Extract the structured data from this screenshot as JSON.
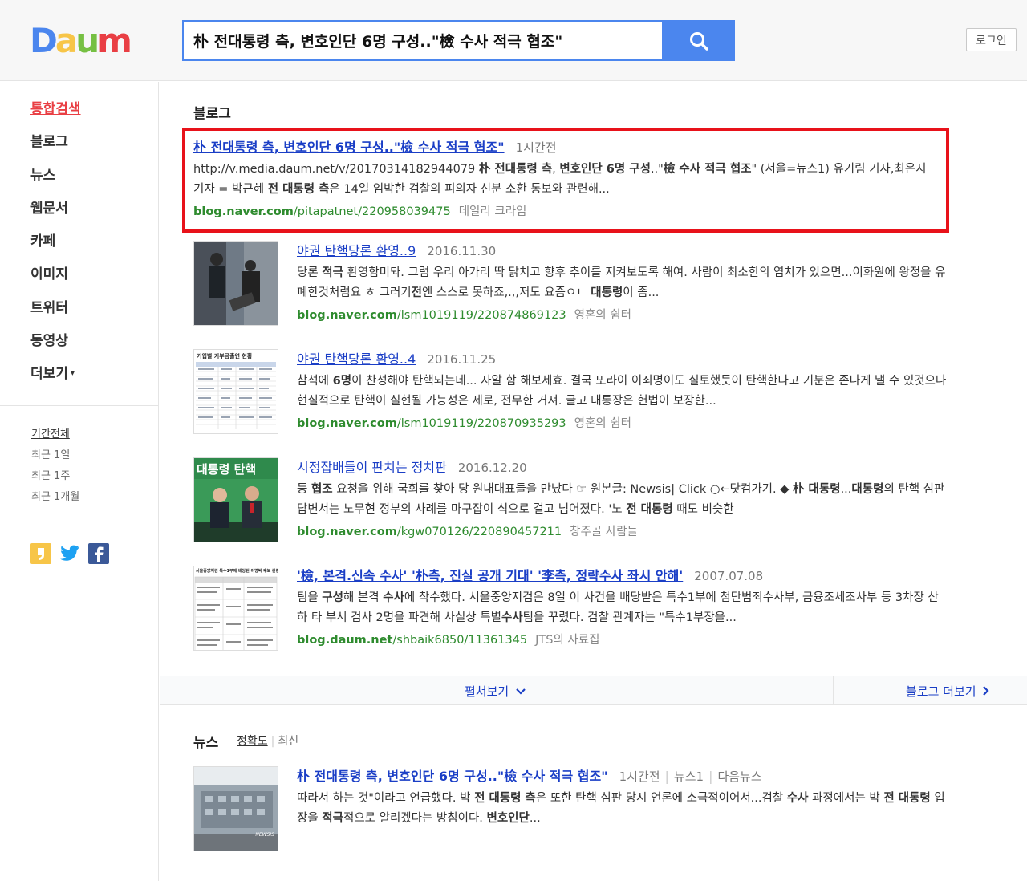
{
  "header": {
    "logo_letters": [
      "D",
      "a",
      "u",
      "m"
    ],
    "logo_colors": [
      "#4b86ee",
      "#f7c548",
      "#76c043",
      "#e93f44"
    ],
    "search_query": "朴 전대통령 측, 변호인단 6명 구성..\"檢 수사 적극 협조\"",
    "search_icon": "search-icon",
    "login_label": "로그인"
  },
  "sidebar": {
    "nav": [
      {
        "label": "통합검색",
        "active": true
      },
      {
        "label": "블로그"
      },
      {
        "label": "뉴스"
      },
      {
        "label": "웹문서"
      },
      {
        "label": "카페"
      },
      {
        "label": "이미지"
      },
      {
        "label": "트위터"
      },
      {
        "label": "동영상"
      },
      {
        "label": "더보기"
      }
    ],
    "more_caret": "▾",
    "period": [
      {
        "label": "기간전체",
        "active": true
      },
      {
        "label": "최근 1일"
      },
      {
        "label": "최근 1주"
      },
      {
        "label": "최근 1개월"
      }
    ],
    "share_icons": [
      "daum-story-icon",
      "twitter-icon",
      "facebook-icon"
    ],
    "colors": {
      "story": "#f7c548",
      "twitter": "#1da1f2",
      "facebook": "#3b5998"
    }
  },
  "blog": {
    "section_title": "블로그",
    "results": [
      {
        "title": "朴 전대통령 측, 변호인단 6명 구성..\"檢 수사 적극 협조\"",
        "date": "1시간전",
        "desc_parts": [
          {
            "t": "http://v.media.daum.net/v/20170314182944079 "
          },
          {
            "t": "朴 전대통령 측",
            "b": true
          },
          {
            "t": ", "
          },
          {
            "t": "변호인단 6명 구성",
            "b": true
          },
          {
            "t": "..\""
          },
          {
            "t": "檢 수사 적극 협조",
            "b": true
          },
          {
            "t": "\" (서울=뉴스1) 유기림 기자,최은지 기자 = 박근혜 "
          },
          {
            "t": "전 대통령 측",
            "b": true
          },
          {
            "t": "은 14일 임박한 검찰의 피의자 신분 소환 통보와 관련해..."
          }
        ],
        "url_domain": "blog.naver.com",
        "url_path": "/pitapatnet/220958039475",
        "source": "데일리 크라임"
      },
      {
        "title": "야권 탄핵당론 환영..9",
        "date": "2016.11.30",
        "desc_parts": [
          {
            "t": "당론 "
          },
          {
            "t": "적극",
            "b": true
          },
          {
            "t": " 환영함미돠. 그럼 우리 아가리 딱 닭치고 향후 추이를 지켜보도록 해여. 사람이 최소한의 염치가 있으면...이화원에 왕정을 유폐한것처럼요 ㅎ 그러기"
          },
          {
            "t": "전",
            "b": true
          },
          {
            "t": "엔 스스로 못하죠,.,,저도 요즘ㅇㄴ "
          },
          {
            "t": "대통령",
            "b": true
          },
          {
            "t": "이 좀..."
          }
        ],
        "url_domain": "blog.naver.com",
        "url_path": "/lsm1019119/220874869123",
        "source": "영혼의 쉼터"
      },
      {
        "title": "야권 탄핵당론 환영..4",
        "date": "2016.11.25",
        "thumb_label": "기업별 기부금출연 현황",
        "desc_parts": [
          {
            "t": "참석에 "
          },
          {
            "t": "6명",
            "b": true
          },
          {
            "t": "이 찬성해야 탄핵되는데... 자알 함 해보세효. 결국 또라이 이죄명이도 실토했듯이 탄핵한다고 기분은 존나게 낼 수 있것으나 현실적으로 탄핵이 실현될 가능성은 제로, 전무한 거져. 글고 대통장은 헌법이 보장한..."
          }
        ],
        "url_domain": "blog.naver.com",
        "url_path": "/lsm1019119/220870935293",
        "source": "영혼의 쉼터"
      },
      {
        "title": "시정잡배들이 판치는 정치판",
        "date": "2016.12.20",
        "thumb_label": "대통령 탄핵",
        "desc_parts": [
          {
            "t": "등 "
          },
          {
            "t": "협조",
            "b": true
          },
          {
            "t": " 요청을 위해 국회를 찾아 당 원내대표들을 만났다 ☞ 원본글: Newsis| Click ○←닷컴가기. ◆ "
          },
          {
            "t": "朴 대통령",
            "b": true
          },
          {
            "t": "..."
          },
          {
            "t": "대통령",
            "b": true
          },
          {
            "t": "의 탄핵 심판 답변서는 노무현 정부의 사례를 마구잡이 식으로 걸고 넘어졌다. '노 "
          },
          {
            "t": "전 대통령",
            "b": true
          },
          {
            "t": " 때도 비슷한"
          }
        ],
        "url_domain": "blog.naver.com",
        "url_path": "/kgw070126/220890457211",
        "source": "창주골 사람들"
      },
      {
        "title": "'檢, 본격.신속 수사' '朴측, 진실 공개 기대' '李측, 정략수사 좌시 안해'",
        "date": "2007.07.08",
        "thumb_label": "서울중앙지검 특수1부에 배당된 이명박 후보 관련",
        "desc_parts": [
          {
            "t": "팀을 "
          },
          {
            "t": "구성",
            "b": true
          },
          {
            "t": "해 본격 "
          },
          {
            "t": "수사",
            "b": true
          },
          {
            "t": "에 착수했다. 서울중앙지검은 8일 이 사건을 배당받은 특수1부에 첨단범죄수사부, 금융조세조사부 등 3차장 산하 타 부서 검사 2명을 파견해 사실상 특별"
          },
          {
            "t": "수사",
            "b": true
          },
          {
            "t": "팀을 꾸렸다. 검찰 관계자는 \"특수1부장을..."
          }
        ],
        "url_domain": "blog.daum.net",
        "url_path": "/shbaik6850/11361345",
        "source": "JTS의 자료집"
      }
    ],
    "expand_label": "펼쳐보기",
    "expand_icon": "chevron-down-icon",
    "more_label": "블로그 더보기",
    "more_icon": "chevron-right-icon"
  },
  "news": {
    "section_title": "뉴스",
    "sort_accuracy": "정확도",
    "sort_latest": "최신",
    "result": {
      "title": "朴 전대통령 측, 변호인단 6명 구성..\"檢 수사 적극 협조\"",
      "time": "1시간전",
      "press": "뉴스1",
      "portal": "다음뉴스",
      "desc_parts": [
        {
          "t": "따라서 하는 것\"이라고 언급했다. 박 "
        },
        {
          "t": "전 대통령 측",
          "b": true
        },
        {
          "t": "은 또한 탄핵 심판 당시 언론에 소극적이어서...검찰 "
        },
        {
          "t": "수사",
          "b": true
        },
        {
          "t": " 과정에서는 박 "
        },
        {
          "t": "전 대통령",
          "b": true
        },
        {
          "t": " 입장을 "
        },
        {
          "t": "적극",
          "b": true
        },
        {
          "t": "적으로 알리겠다는 방침이다. "
        },
        {
          "t": "변호인단",
          "b": true
        },
        {
          "t": "..."
        }
      ],
      "thumb_label": "NEWSIS"
    }
  },
  "colors": {
    "accent": "#4b86ee",
    "link": "#1a3ec6",
    "url": "#2e8b2e",
    "highlight": "#e8121a",
    "active_nav": "#e93f44"
  }
}
